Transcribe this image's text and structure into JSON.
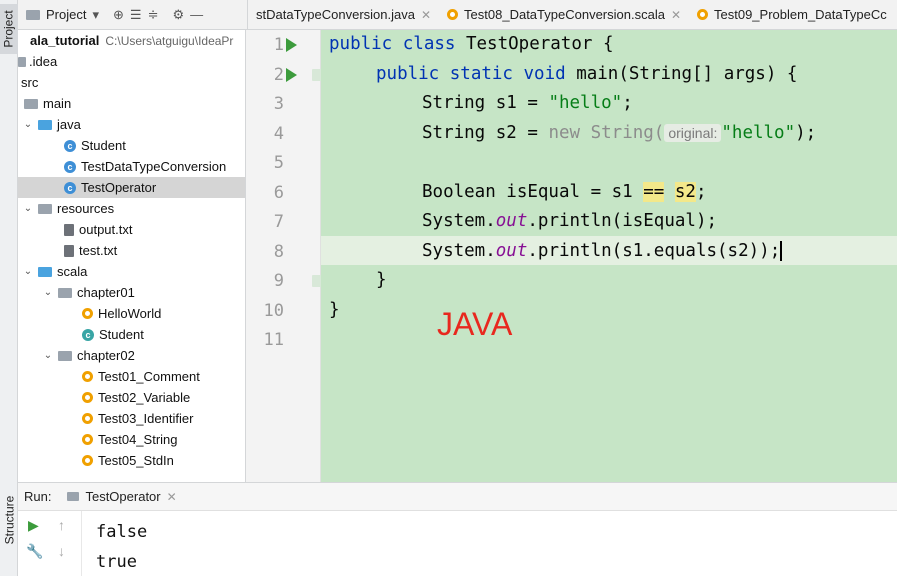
{
  "tool_strip": {
    "project_tab": "Project",
    "structure_tab": "Structure"
  },
  "project_panel": {
    "title": "Project"
  },
  "tabs": [
    {
      "label": "stDataTypeConversion.java",
      "icon": "java-class-icon"
    },
    {
      "label": "Test08_DataTypeConversion.scala",
      "icon": "scala-object-icon"
    },
    {
      "label": "Test09_Problem_DataTypeCc",
      "icon": "scala-object-icon"
    }
  ],
  "tree": {
    "root_name": "ala_tutorial",
    "root_path": "C:\\Users\\atguigu\\IdeaPr",
    "items": [
      {
        "label": ".idea"
      },
      {
        "label": "src"
      },
      {
        "label": "main"
      },
      {
        "label": "java"
      },
      {
        "label": "Student"
      },
      {
        "label": "TestDataTypeConversion"
      },
      {
        "label": "TestOperator"
      },
      {
        "label": "resources"
      },
      {
        "label": "output.txt"
      },
      {
        "label": "test.txt"
      },
      {
        "label": "scala"
      },
      {
        "label": "chapter01"
      },
      {
        "label": "HelloWorld"
      },
      {
        "label": "Student"
      },
      {
        "label": "chapter02"
      },
      {
        "label": "Test01_Comment"
      },
      {
        "label": "Test02_Variable"
      },
      {
        "label": "Test03_Identifier"
      },
      {
        "label": "Test04_String"
      },
      {
        "label": "Test05_StdIn"
      }
    ]
  },
  "editor": {
    "line_numbers": [
      "1",
      "2",
      "3",
      "4",
      "5",
      "6",
      "7",
      "8",
      "9",
      "10",
      "11"
    ],
    "code": {
      "l1_kw": "public class",
      "l1_rest": " TestOperator {",
      "l2_kw": "public static void",
      "l2_rest": " main(String[] args) {",
      "l3_a": "String s1 = ",
      "l3_str": "\"hello\"",
      "l3_end": ";",
      "l4_a": "String s2 = ",
      "l4_new": "new String(",
      "l4_hint": "original:",
      "l4_str": "\"hello\"",
      "l4_end": ");",
      "l6_a": "Boolean isEqual = s1 ",
      "l6_op": "==",
      "l6_s2": "s2",
      "l6_end": ";",
      "l7_a": "System.",
      "l7_out": "out",
      "l7_b": ".println(isEqual);",
      "l8_a": "System.",
      "l8_out": "out",
      "l8_b": ".println(s1.equals(s2));",
      "l9": "}",
      "l10": "}"
    },
    "overlay_label": "JAVA"
  },
  "run_panel": {
    "label": "Run:",
    "tab_label": "TestOperator",
    "output": [
      "false",
      "true"
    ]
  }
}
